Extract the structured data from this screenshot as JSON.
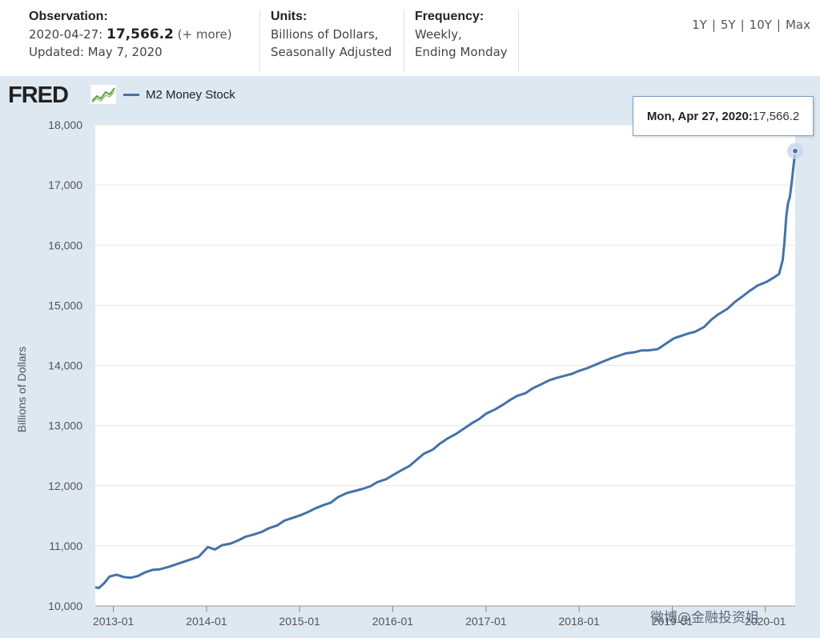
{
  "header": {
    "observation": {
      "heading": "Observation:",
      "date_prefix": "2020-04-27: ",
      "value": "17,566.2",
      "more": " (+ more)",
      "updated": "Updated: May 7, 2020"
    },
    "units": {
      "heading": "Units:",
      "line1": "Billions of Dollars,",
      "line2": "Seasonally Adjusted"
    },
    "frequency": {
      "heading": "Frequency:",
      "line1": "Weekly,",
      "line2": "Ending Monday"
    },
    "range_buttons": [
      "1Y",
      "5Y",
      "10Y",
      "Max"
    ]
  },
  "logo": "FRED",
  "tooltip": {
    "date": "Mon, Apr 27, 2020:",
    "value": " 17,566.2"
  },
  "watermark": "微博@金融投资姐",
  "colors": {
    "series": "#4572a7",
    "panel_bg": "#dde8f1",
    "grid": "#e6e6e6"
  },
  "chart_data": {
    "type": "line",
    "title": "",
    "xlabel": "",
    "ylabel": "Billions of Dollars",
    "ylim": [
      10000,
      18000
    ],
    "yticks": [
      10000,
      11000,
      12000,
      13000,
      14000,
      15000,
      16000,
      17000,
      18000
    ],
    "ytick_labels": [
      "10,000",
      "11,000",
      "12,000",
      "13,000",
      "14,000",
      "15,000",
      "16,000",
      "17,000",
      "18,000"
    ],
    "xlim": [
      "2012-10-22",
      "2020-04-27"
    ],
    "xticks": [
      "2013-01",
      "2014-01",
      "2015-01",
      "2016-01",
      "2017-01",
      "2018-01",
      "2019-01",
      "2020-01"
    ],
    "grid": true,
    "legend_position": "top-left",
    "series": [
      {
        "name": "M2 Money Stock",
        "x": [
          "2012-10-22",
          "2012-11-05",
          "2012-11-26",
          "2012-12-17",
          "2013-01-14",
          "2013-02-11",
          "2013-03-11",
          "2013-04-08",
          "2013-05-06",
          "2013-06-03",
          "2013-07-01",
          "2013-08-05",
          "2013-09-02",
          "2013-10-07",
          "2013-11-04",
          "2013-12-02",
          "2014-01-06",
          "2014-02-03",
          "2014-03-03",
          "2014-04-07",
          "2014-05-05",
          "2014-06-02",
          "2014-07-07",
          "2014-08-04",
          "2014-09-01",
          "2014-10-06",
          "2014-11-03",
          "2014-12-01",
          "2015-01-05",
          "2015-02-02",
          "2015-03-02",
          "2015-04-06",
          "2015-05-04",
          "2015-06-01",
          "2015-07-06",
          "2015-08-03",
          "2015-09-07",
          "2015-10-05",
          "2015-11-02",
          "2015-12-07",
          "2016-01-04",
          "2016-02-01",
          "2016-03-07",
          "2016-04-04",
          "2016-05-02",
          "2016-06-06",
          "2016-07-04",
          "2016-08-01",
          "2016-09-05",
          "2016-10-03",
          "2016-11-07",
          "2016-12-05",
          "2017-01-02",
          "2017-02-06",
          "2017-03-06",
          "2017-04-03",
          "2017-05-01",
          "2017-06-05",
          "2017-07-03",
          "2017-08-07",
          "2017-09-04",
          "2017-10-02",
          "2017-11-06",
          "2017-12-04",
          "2018-01-01",
          "2018-02-05",
          "2018-03-05",
          "2018-04-02",
          "2018-05-07",
          "2018-06-04",
          "2018-07-02",
          "2018-08-06",
          "2018-09-03",
          "2018-10-01",
          "2018-11-05",
          "2018-12-03",
          "2019-01-07",
          "2019-02-04",
          "2019-03-04",
          "2019-04-01",
          "2019-05-06",
          "2019-06-03",
          "2019-07-01",
          "2019-08-05",
          "2019-09-02",
          "2019-10-07",
          "2019-11-04",
          "2019-12-02",
          "2020-01-06",
          "2020-02-03",
          "2020-02-24",
          "2020-03-09",
          "2020-03-16",
          "2020-03-23",
          "2020-03-30",
          "2020-04-06",
          "2020-04-13",
          "2020-04-20",
          "2020-04-27"
        ],
        "values": [
          10310,
          10300,
          10380,
          10490,
          10520,
          10480,
          10470,
          10500,
          10560,
          10600,
          10610,
          10650,
          10690,
          10740,
          10780,
          10820,
          10980,
          10940,
          11010,
          11040,
          11090,
          11150,
          11190,
          11230,
          11290,
          11340,
          11420,
          11460,
          11510,
          11560,
          11620,
          11680,
          11720,
          11810,
          11880,
          11910,
          11950,
          11990,
          12060,
          12110,
          12180,
          12250,
          12330,
          12430,
          12530,
          12600,
          12700,
          12780,
          12860,
          12940,
          13040,
          13110,
          13200,
          13270,
          13340,
          13420,
          13490,
          13540,
          13620,
          13690,
          13750,
          13790,
          13830,
          13860,
          13910,
          13960,
          14010,
          14060,
          14120,
          14160,
          14200,
          14220,
          14250,
          14250,
          14270,
          14350,
          14450,
          14490,
          14530,
          14560,
          14640,
          14760,
          14850,
          14940,
          15050,
          15160,
          15250,
          15330,
          15390,
          15460,
          15520,
          15750,
          16050,
          16480,
          16700,
          16800,
          17020,
          17300,
          17566.2
        ]
      }
    ]
  }
}
